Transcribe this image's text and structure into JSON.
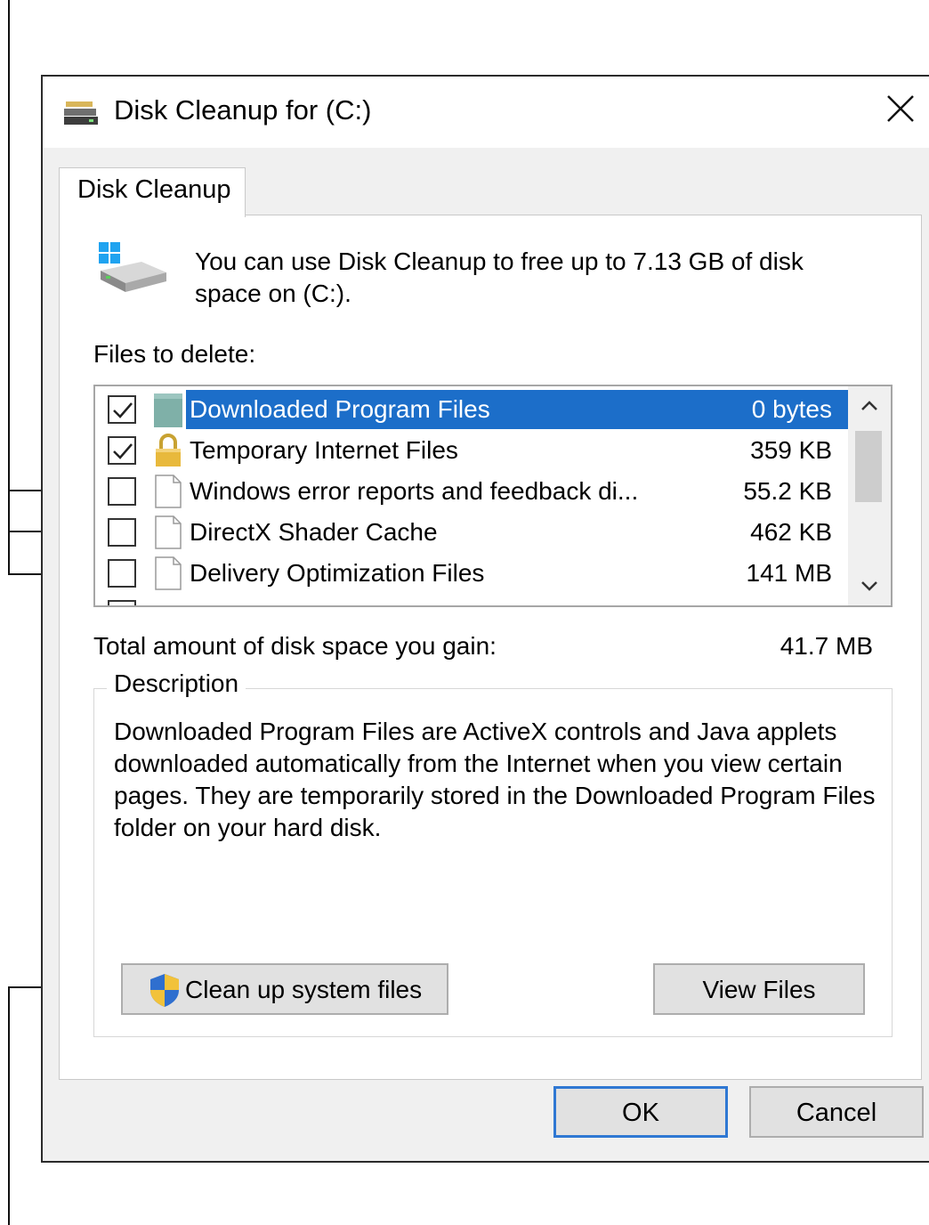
{
  "window": {
    "title": "Disk Cleanup for  (C:)"
  },
  "tabs": [
    {
      "label": "Disk Cleanup"
    }
  ],
  "intro_text": "You can use Disk Cleanup to free up to 7.13 GB of disk space on  (C:).",
  "files_label": "Files to delete:",
  "files": [
    {
      "name": "Downloaded Program Files",
      "size": "0 bytes",
      "checked": true,
      "selected": true,
      "icon": "folder-icon"
    },
    {
      "name": "Temporary Internet Files",
      "size": "359 KB",
      "checked": true,
      "selected": false,
      "icon": "lock-icon"
    },
    {
      "name": "Windows error reports and feedback di...",
      "size": "55.2 KB",
      "checked": false,
      "selected": false,
      "icon": "file-icon"
    },
    {
      "name": "DirectX Shader Cache",
      "size": "462 KB",
      "checked": false,
      "selected": false,
      "icon": "file-icon"
    },
    {
      "name": "Delivery Optimization Files",
      "size": "141 MB",
      "checked": false,
      "selected": false,
      "icon": "file-icon"
    }
  ],
  "total": {
    "label": "Total amount of disk space you gain:",
    "value": "41.7 MB"
  },
  "description": {
    "legend": "Description",
    "text": "Downloaded Program Files are ActiveX controls and Java applets downloaded automatically from the Internet when you view certain pages. They are temporarily stored in the Downloaded Program Files folder on your hard disk."
  },
  "buttons": {
    "cleanup_system": "Clean up system files",
    "view_files": "View Files",
    "ok": "OK",
    "cancel": "Cancel"
  },
  "colors": {
    "selection": "#1c6ec9",
    "default_button_border": "#2f78d3",
    "dialog_background": "#f0f0f0"
  }
}
